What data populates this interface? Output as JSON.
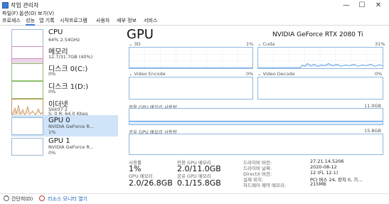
{
  "window": {
    "title": "작업 관리자",
    "min_icon": "—",
    "max_icon": "☐",
    "close_icon": "✕"
  },
  "menu": [
    "파일(F)",
    "옵션(O)",
    "보기(V)"
  ],
  "tabs": [
    "프로세스",
    "성능",
    "앱 기록",
    "시작프로그램",
    "사용자",
    "세부 정보",
    "서비스"
  ],
  "active_tab": 1,
  "sidebar": {
    "items": [
      {
        "name": "CPU",
        "sub": "64% 2.54GHz",
        "sub2": ""
      },
      {
        "name": "메모리",
        "sub": "12.7/31.7GB (40%)",
        "sub2": ""
      },
      {
        "name": "디스크 0(C:)",
        "sub": "0%",
        "sub2": ""
      },
      {
        "name": "디스크 1(D:)",
        "sub": "0%",
        "sub2": ""
      },
      {
        "name": "이더넷",
        "sub": "Slot07 2",
        "sub2": "S: 0 R: 64.0 Kbps"
      },
      {
        "name": "GPU 0",
        "sub": "NVIDIA GeForce R...",
        "sub2": "1%"
      },
      {
        "name": "GPU 1",
        "sub": "NVIDIA GeForce R...",
        "sub2": "0%"
      }
    ]
  },
  "main": {
    "title": "GPU",
    "model": "NVIDIA GeForce RTX 2080 Ti",
    "engines": [
      {
        "name": "3D",
        "pct": "1%"
      },
      {
        "name": "Cuda",
        "pct": "31%"
      },
      {
        "name": "Video Encode",
        "pct": "0%"
      },
      {
        "name": "Video Decode",
        "pct": "0%"
      }
    ],
    "dedicated_label": "전용 GPU 메모리 사용량",
    "dedicated_max": "11.0GB",
    "shared_label": "공유 GPU 메모리 사용량",
    "shared_max": "15.8GB"
  },
  "stats": {
    "util_label": "사용률",
    "util_value": "1%",
    "ded_label": "전용 GPU 메모리",
    "ded_value": "2.0/11.0GB",
    "gpu_mem_label": "GPU 메모리",
    "gpu_mem_value": "2.0/26.8GB",
    "shared_label": "공유 GPU 메모리",
    "shared_value": "0.1/15.8GB"
  },
  "info": [
    {
      "label": "드라이버 버전:",
      "value": "27.21.14.5206"
    },
    {
      "label": "드라이버 날짜:",
      "value": "2020-08-12"
    },
    {
      "label": "DirectX 버전:",
      "value": "12 (FL 12.1)"
    },
    {
      "label": "실제 위치:",
      "value": "PCI 버스 24, 장치 0, 기..."
    },
    {
      "label": "하드웨어 예약 메모리:",
      "value": "215MB"
    }
  ],
  "footer": {
    "fewer_details": "간단히(D)",
    "resource_monitor": "리소스 모니터 열기"
  }
}
